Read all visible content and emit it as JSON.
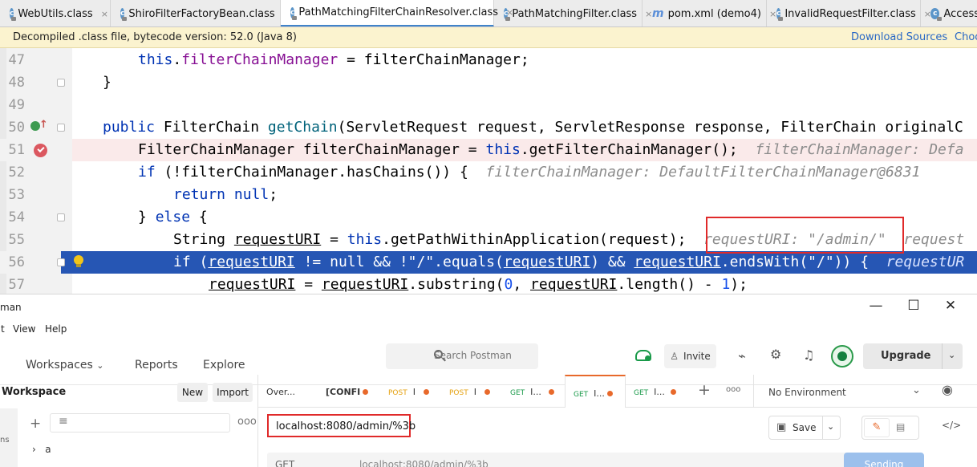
{
  "ide": {
    "tabs": [
      {
        "label": "WebUtils.class",
        "icon": "class-icon"
      },
      {
        "label": "ShiroFilterFactoryBean.class",
        "icon": "class-icon"
      },
      {
        "label": "PathMatchingFilterChainResolver.class",
        "icon": "class-icon",
        "active": true
      },
      {
        "label": "PathMatchingFilter.class",
        "icon": "class-icon"
      },
      {
        "label": "pom.xml (demo4)",
        "icon": "maven-icon"
      },
      {
        "label": "InvalidRequestFilter.class",
        "icon": "class-icon"
      },
      {
        "label": "Access",
        "icon": "class-icon"
      }
    ],
    "icon_letter": "c",
    "maven_letter": "m",
    "close_glyph": "×",
    "banner": {
      "text": "Decompiled .class file, bytecode version: 52.0 (Java 8)",
      "download_sources": "Download Sources",
      "choose_sources": "Choo"
    },
    "line_numbers": [
      "47",
      "48",
      "49",
      "50",
      "51",
      "52",
      "53",
      "54",
      "55",
      "56",
      "57"
    ],
    "code": {
      "l47": {
        "this": "this",
        "dot": ".",
        "field": "filterChainManager",
        "rest": " = filterChainManager;"
      },
      "l48": "}",
      "l50": {
        "public": "public ",
        "type": "FilterChain ",
        "method": "getChain",
        "rest": "(ServletRequest request, ServletResponse response, FilterChain originalC"
      },
      "l51": {
        "a": "FilterChainManager filterChainManager = ",
        "this": "this",
        "b": ".getFilterChainManager();",
        "hint": "filterChainManager: Defa"
      },
      "l52": {
        "if": "if",
        "a": " (!filterChainManager.hasChains()) {",
        "hint": "filterChainManager: DefaultFilterChainManager@6831"
      },
      "l53": {
        "return": "return",
        "sp": " ",
        "null": "null",
        "semi": ";"
      },
      "l54": {
        "a": "} ",
        "else": "else",
        "b": " {"
      },
      "l55": {
        "a": "String ",
        "var": "requestURI",
        "b": " = ",
        "this": "this",
        "c": ".getPathWithinApplication(request);",
        "hint1": "requestURI: \"/admin/\"",
        "hint2": "request"
      },
      "l56": {
        "if": "if",
        "a": " (",
        "v1": "requestURI",
        "b": " != ",
        "null": "null",
        "c": " && !\"/\".equals(",
        "v2": "requestURI",
        "d": ") && ",
        "v3": "requestURI",
        "e": ".endsWith(\"/\")) {",
        "hint": "requestUR"
      },
      "l57": {
        "v1": "requestURI",
        "a": " = ",
        "v2": "requestURI",
        "b": ".substring(",
        "n0": "0",
        "c": ", ",
        "v3": "requestURI",
        "d": ".length() - ",
        "n1": "1",
        "e": ");"
      }
    }
  },
  "postman": {
    "window_title": "man",
    "window_controls": {
      "minimize": "—",
      "maximize": "☐",
      "close": "✕"
    },
    "menu": [
      "t",
      "View",
      "Help"
    ],
    "nav": {
      "workspaces": "Workspaces",
      "chevron": "⌄",
      "reports": "Reports",
      "explore": "Explore"
    },
    "search_placeholder": "Search Postman",
    "invite": "Invite",
    "upgrade": "Upgrade",
    "upgrade_chevron": "⌄",
    "sidebar": {
      "title": "Workspace",
      "new": "New",
      "import": "Import",
      "rail_label": "ns",
      "plus": "+",
      "more": "ooo",
      "item_arrow": "›",
      "item": "a"
    },
    "request_tabs": [
      {
        "label": "Over..."
      },
      {
        "label": "[CONFI",
        "dot": true
      },
      {
        "method": "POST",
        "label": "I",
        "dot": true
      },
      {
        "method": "POST",
        "label": "I",
        "dot": true
      },
      {
        "method": "GET",
        "label": "I...",
        "dot": true
      },
      {
        "method": "GET",
        "label": "I...",
        "dot": true,
        "active": true
      },
      {
        "method": "GET",
        "label": "I...",
        "dot": true
      }
    ],
    "tab_add": "+",
    "tab_more": "ooo",
    "environment": "No Environment",
    "env_chevron": "⌄",
    "url": "localhost:8080/admin/%3b",
    "save": "Save",
    "save_chevron": "⌄",
    "method_partial": "GET",
    "url_partial": "localhost:8080/admin/%3b",
    "send_partial": "Sending",
    "code_icon": "</>",
    "eye_icon": "◉"
  }
}
